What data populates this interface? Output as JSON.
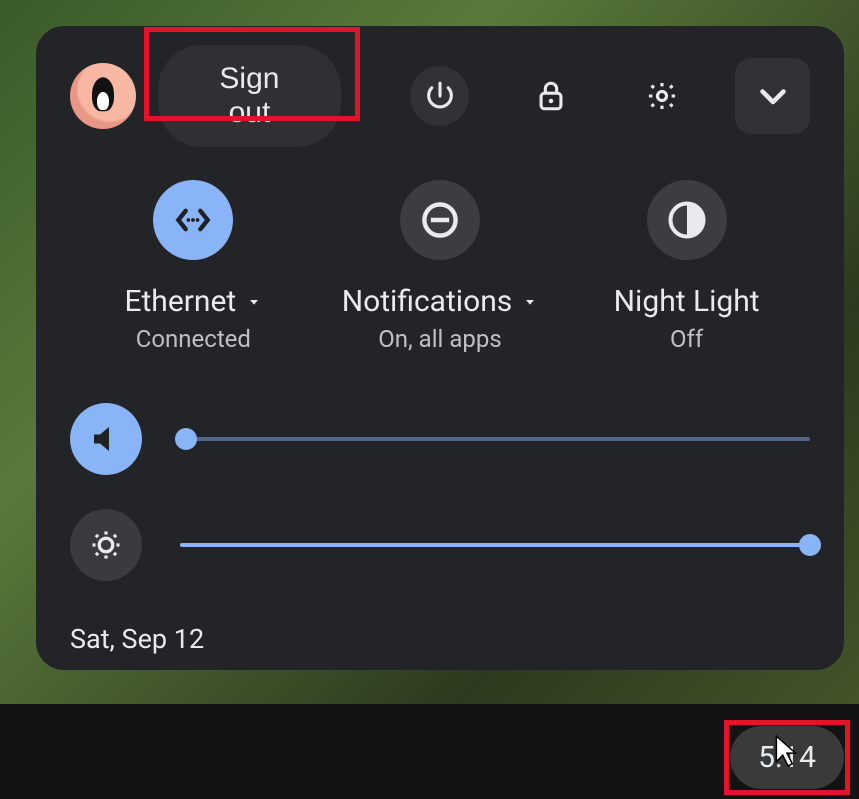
{
  "header": {
    "sign_out_label": "Sign out"
  },
  "tiles": {
    "network": {
      "title": "Ethernet",
      "status": "Connected",
      "has_submenu": true,
      "active": true
    },
    "notifications": {
      "title": "Notifications",
      "status": "On, all apps",
      "has_submenu": true,
      "active": false
    },
    "nightlight": {
      "title": "Night Light",
      "status": "Off",
      "has_submenu": false,
      "active": false
    }
  },
  "sliders": {
    "volume": {
      "percent": 1
    },
    "brightness": {
      "percent": 100
    }
  },
  "date": "Sat, Sep 12",
  "clock": "5:14",
  "colors": {
    "accent": "#8ab4f8",
    "panel": "#232427",
    "highlight": "#e3142a"
  }
}
